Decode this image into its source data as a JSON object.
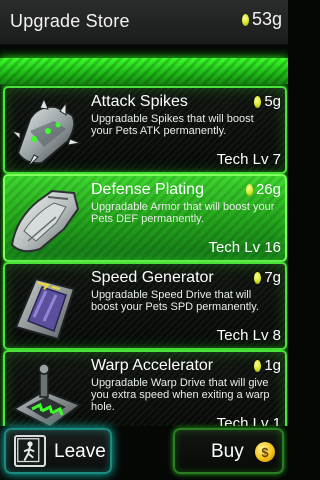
{
  "header": {
    "title": "Upgrade Store",
    "gold": "53g"
  },
  "colors": {
    "accent_green": "#3cff2a",
    "selected_green": "#2fbf25",
    "leave_glow": "#16c8b8",
    "coin_yellow": "#e3ee27"
  },
  "items": [
    {
      "name": "Attack Spikes",
      "price": "5g",
      "description": "Upgradable Spikes that will boost your Pets ATK permanently.",
      "tech": "Tech Lv 7",
      "icon": "spiked-bracer-icon",
      "selected": false
    },
    {
      "name": "Defense Plating",
      "price": "26g",
      "description": "Upgradable Armor that will boost your Pets DEF permanently.",
      "tech": "Tech Lv 16",
      "icon": "armor-plate-icon",
      "selected": true
    },
    {
      "name": "Speed Generator",
      "price": "7g",
      "description": "Upgradable Speed Drive that will boost your Pets SPD permanently.",
      "tech": "Tech Lv 8",
      "icon": "speed-generator-icon",
      "selected": false
    },
    {
      "name": "Warp Accelerator",
      "price": "1g",
      "description": "Upgradable Warp Drive that will give you extra speed when exiting a warp hole.",
      "tech": "Tech Lv 1",
      "icon": "warp-accelerator-icon",
      "selected": false
    }
  ],
  "buttons": {
    "leave": "Leave",
    "buy": "Buy",
    "leave_icon": "exit-door-icon",
    "buy_icon": "coin-icon",
    "coin_symbol": "$"
  }
}
